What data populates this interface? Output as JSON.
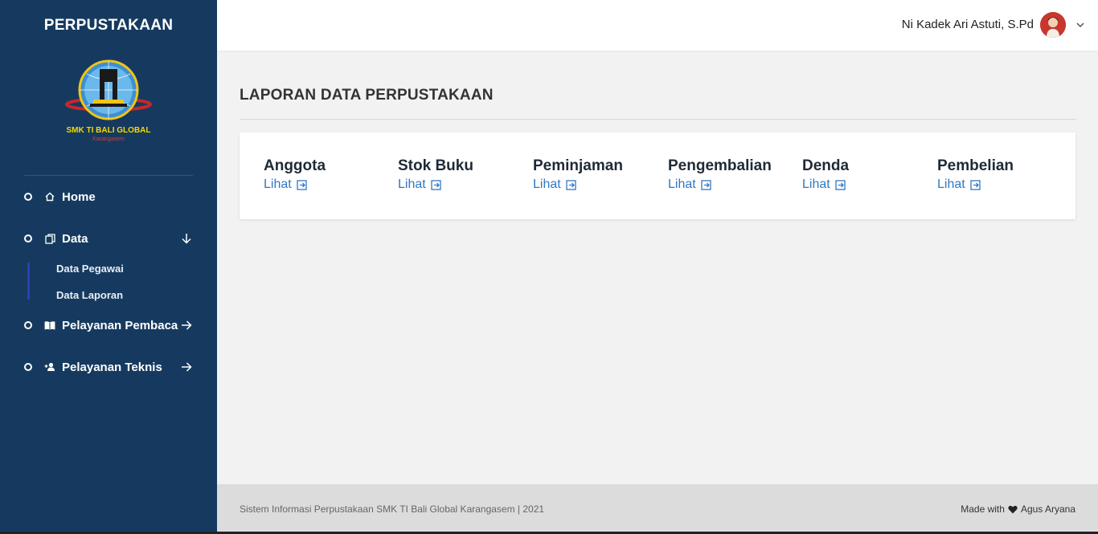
{
  "sidebar": {
    "brand": "PERPUSTAKAAN",
    "logo_text": "SMK TI BALI GLOBAL",
    "logo_subtext": "Karangasem",
    "items": [
      {
        "label": "Home",
        "icon": "home-icon"
      },
      {
        "label": "Data",
        "icon": "copy-icon",
        "expanded": true,
        "children": [
          "Data Pegawai",
          "Data Laporan"
        ]
      },
      {
        "label": "Pelayanan Pembaca",
        "icon": "book-open-icon"
      },
      {
        "label": "Pelayanan Teknis",
        "icon": "user-plus-icon"
      }
    ]
  },
  "header": {
    "user_name": "Ni Kadek Ari Astuti, S.Pd"
  },
  "main": {
    "title": "LAPORAN DATA PERPUSTAKAAN",
    "cards": [
      {
        "title": "Anggota",
        "link": "Lihat"
      },
      {
        "title": "Stok Buku",
        "link": "Lihat"
      },
      {
        "title": "Peminjaman",
        "link": "Lihat"
      },
      {
        "title": "Pengembalian",
        "link": "Lihat"
      },
      {
        "title": "Denda",
        "link": "Lihat"
      },
      {
        "title": "Pembelian",
        "link": "Lihat"
      }
    ]
  },
  "footer": {
    "left": "Sistem Informasi Perpustakaan SMK TI Bali Global Karangasem | 2021",
    "made_with": "Made with",
    "author": "Agus Aryana"
  },
  "colors": {
    "sidebar_bg": "#163a5f",
    "accent_link": "#2f78c4",
    "submenu_bar": "#2c3fb8"
  }
}
